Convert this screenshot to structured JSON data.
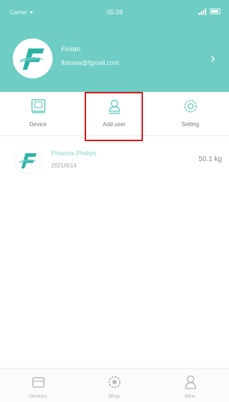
{
  "status_bar": {
    "carrier": "Carrier ✦",
    "time": "05:28"
  },
  "profile": {
    "name": "Finlan",
    "email": "fbissea@fgmail.com"
  },
  "actions": [
    {
      "label": "Device",
      "icon": "device-box-icon"
    },
    {
      "label": "Add user",
      "icon": "person-add-icon"
    },
    {
      "label": "Setting",
      "icon": "gear-icon"
    }
  ],
  "user": {
    "name": "Phoenix Phillips",
    "date": "2021/6/14",
    "weight": "50.1 kg"
  },
  "tabs": [
    {
      "label": "Devices",
      "icon": "scale-icon"
    },
    {
      "label": "Shop",
      "icon": "gear-icon"
    },
    {
      "label": "Mine",
      "icon": "person-icon"
    }
  ],
  "colors": {
    "header": "#6ecdc4",
    "highlight": "#e0141b",
    "accent": "#2bb3a6"
  }
}
